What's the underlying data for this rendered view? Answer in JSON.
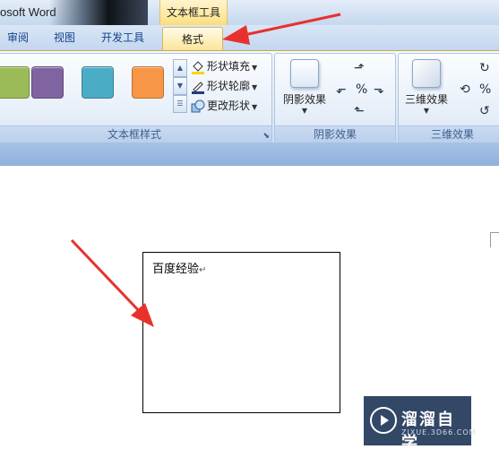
{
  "window": {
    "title": "osoft Word",
    "context_tab_group": "文本框工具"
  },
  "tabs": [
    {
      "label": "审阅",
      "active": false
    },
    {
      "label": "视图",
      "active": false
    },
    {
      "label": "开发工具",
      "active": false
    },
    {
      "label": "格式",
      "active": true
    }
  ],
  "ribbon": {
    "textbox_styles": {
      "label": "文本框样式",
      "swatches": [
        "#9bbb59",
        "#8064a2",
        "#4bacc6",
        "#f79646"
      ],
      "commands": [
        {
          "label": "形状填充",
          "icon": "paint-bucket-icon"
        },
        {
          "label": "形状轮廓",
          "icon": "pencil-outline-icon"
        },
        {
          "label": "更改形状",
          "icon": "change-shape-icon"
        }
      ]
    },
    "shadow_effects": {
      "label": "阴影效果",
      "button": "阴影效果"
    },
    "three_d_effects": {
      "label": "三维效果",
      "button": "三维效果"
    }
  },
  "document": {
    "textbox_text": "百度经验",
    "paragraph_mark": "↵"
  },
  "watermark": {
    "title": "溜溜自学",
    "subtitle": "ZIXUE.3D66.COM"
  },
  "colors": {
    "accent_arrow": "#e8312d",
    "active_tab": "#fde79a"
  }
}
